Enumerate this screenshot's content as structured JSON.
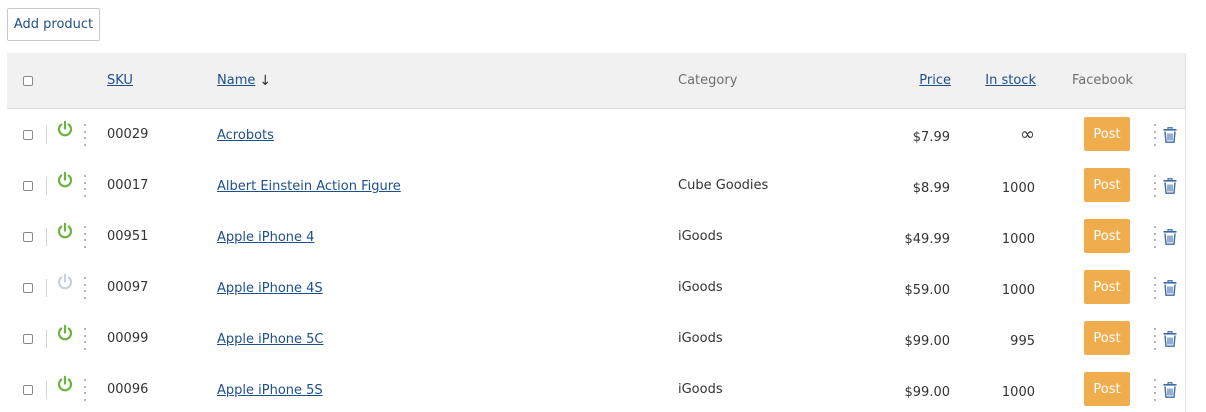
{
  "toolbar": {
    "add_label": "Add product"
  },
  "colors": {
    "accent": "#f0ad4e",
    "link": "#1f4f8b",
    "enabled": "#6bb33f",
    "disabled": "#c9d0db",
    "header_bg": "#f1f1f1"
  },
  "table": {
    "headers": {
      "sku": "SKU",
      "name": "Name",
      "name_sort": "↓",
      "category": "Category",
      "price": "Price",
      "in_stock": "In stock",
      "facebook": "Facebook"
    },
    "post_label": "Post",
    "rows": [
      {
        "sku": "00029",
        "name": "Acrobots",
        "category": "",
        "price": "$7.99",
        "stock": "∞",
        "enabled": true
      },
      {
        "sku": "00017",
        "name": "Albert Einstein Action Figure",
        "category": "Cube Goodies",
        "price": "$8.99",
        "stock": "1000",
        "enabled": true
      },
      {
        "sku": "00951",
        "name": "Apple iPhone 4",
        "category": "iGoods",
        "price": "$49.99",
        "stock": "1000",
        "enabled": true
      },
      {
        "sku": "00097",
        "name": "Apple iPhone 4S",
        "category": "iGoods",
        "price": "$59.00",
        "stock": "1000",
        "enabled": false
      },
      {
        "sku": "00099",
        "name": "Apple iPhone 5C",
        "category": "iGoods",
        "price": "$99.00",
        "stock": "995",
        "enabled": true
      },
      {
        "sku": "00096",
        "name": "Apple iPhone 5S",
        "category": "iGoods",
        "price": "$99.00",
        "stock": "1000",
        "enabled": true
      }
    ]
  }
}
